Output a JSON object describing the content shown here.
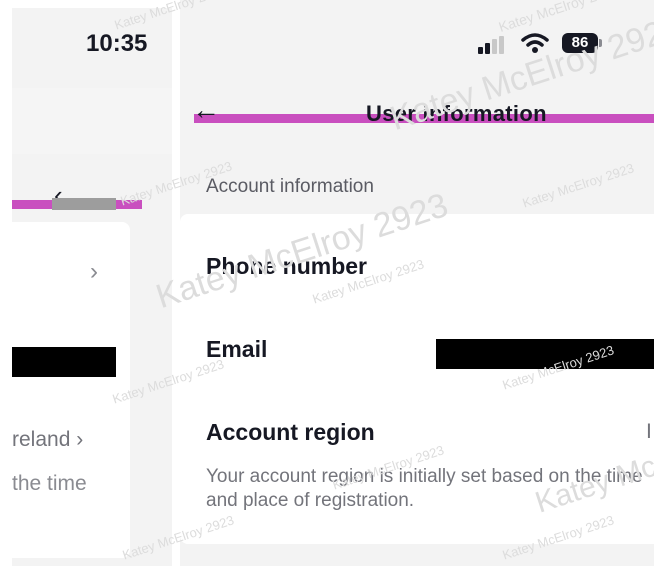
{
  "status_bar": {
    "time": "10:35",
    "battery": "86",
    "icons": [
      "signal-icon",
      "wifi-icon",
      "battery-icon"
    ]
  },
  "previous_screen": {
    "region_value": "reland",
    "description_fragment": "the time"
  },
  "header": {
    "title": "User information"
  },
  "account": {
    "section_title": "Account information",
    "rows": [
      {
        "label": "Phone number"
      },
      {
        "label": "Email"
      },
      {
        "label": "Account region",
        "value": "I"
      }
    ],
    "region_description": "Your account region is initially set based on the time and place of registration."
  },
  "watermark": {
    "text": "Katey McElroy 2923"
  },
  "colors": {
    "redaction_bar": "#c94fbf",
    "background": "#f3f3f3",
    "card": "#ffffff"
  }
}
